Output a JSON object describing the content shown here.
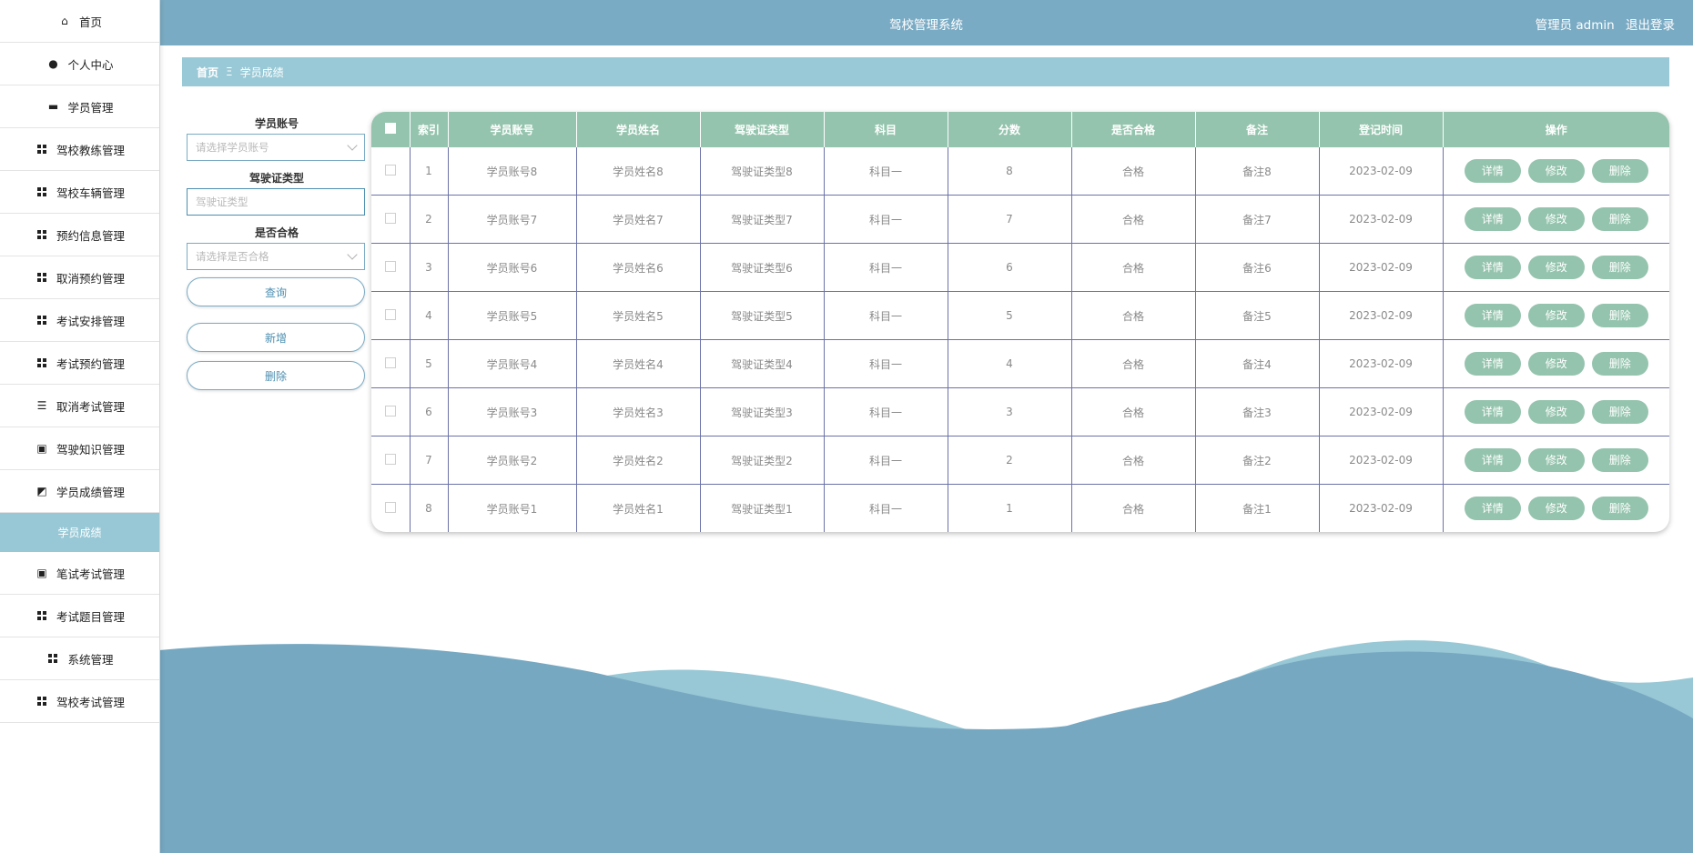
{
  "header": {
    "title": "驾校管理系统",
    "role": "管理员 admin",
    "logout": "退出登录"
  },
  "sidebar": {
    "items": [
      {
        "label": "首页",
        "icon": "home-icon"
      },
      {
        "label": "个人中心",
        "icon": "user-icon"
      },
      {
        "label": "学员管理",
        "icon": "chat-icon"
      },
      {
        "label": "驾校教练管理",
        "icon": "grid-icon"
      },
      {
        "label": "驾校车辆管理",
        "icon": "grid-icon"
      },
      {
        "label": "预约信息管理",
        "icon": "grid-icon"
      },
      {
        "label": "取消预约管理",
        "icon": "grid-icon"
      },
      {
        "label": "考试安排管理",
        "icon": "grid-icon"
      },
      {
        "label": "考试预约管理",
        "icon": "grid-icon"
      },
      {
        "label": "取消考试管理",
        "icon": "list-icon"
      },
      {
        "label": "驾驶知识管理",
        "icon": "clipboard-icon"
      },
      {
        "label": "学员成绩管理",
        "icon": "chart-icon"
      }
    ],
    "active_sub": "学员成绩",
    "items_after": [
      {
        "label": "笔试考试管理",
        "icon": "clipboard-icon"
      },
      {
        "label": "考试题目管理",
        "icon": "grid-icon"
      },
      {
        "label": "系统管理",
        "icon": "grid-icon"
      },
      {
        "label": "驾校考试管理",
        "icon": "grid-icon"
      }
    ]
  },
  "breadcrumb": {
    "home": "首页",
    "separator": "Ξ",
    "current": "学员成绩"
  },
  "search": {
    "account_label": "学员账号",
    "account_placeholder": "请选择学员账号",
    "license_label": "驾驶证类型",
    "license_placeholder": "驾驶证类型",
    "pass_label": "是否合格",
    "pass_placeholder": "请选择是否合格",
    "query_button": "查询",
    "add_button": "新增",
    "delete_button": "删除"
  },
  "table": {
    "headers": [
      "索引",
      "学员账号",
      "学员姓名",
      "驾驶证类型",
      "科目",
      "分数",
      "是否合格",
      "备注",
      "登记时间",
      "操作"
    ],
    "rows": [
      [
        "1",
        "学员账号8",
        "学员姓名8",
        "驾驶证类型8",
        "科目一",
        "8",
        "合格",
        "备注8",
        "2023-02-09"
      ],
      [
        "2",
        "学员账号7",
        "学员姓名7",
        "驾驶证类型7",
        "科目一",
        "7",
        "合格",
        "备注7",
        "2023-02-09"
      ],
      [
        "3",
        "学员账号6",
        "学员姓名6",
        "驾驶证类型6",
        "科目一",
        "6",
        "合格",
        "备注6",
        "2023-02-09"
      ],
      [
        "4",
        "学员账号5",
        "学员姓名5",
        "驾驶证类型5",
        "科目一",
        "5",
        "合格",
        "备注5",
        "2023-02-09"
      ],
      [
        "5",
        "学员账号4",
        "学员姓名4",
        "驾驶证类型4",
        "科目一",
        "4",
        "合格",
        "备注4",
        "2023-02-09"
      ],
      [
        "6",
        "学员账号3",
        "学员姓名3",
        "驾驶证类型3",
        "科目一",
        "3",
        "合格",
        "备注3",
        "2023-02-09"
      ],
      [
        "7",
        "学员账号2",
        "学员姓名2",
        "驾驶证类型2",
        "科目一",
        "2",
        "合格",
        "备注2",
        "2023-02-09"
      ],
      [
        "8",
        "学员账号1",
        "学员姓名1",
        "驾驶证类型1",
        "科目一",
        "1",
        "合格",
        "备注1",
        "2023-02-09"
      ]
    ],
    "actions": {
      "detail": "详情",
      "edit": "修改",
      "delete": "删除"
    }
  },
  "colors": {
    "header": "#7aabc4",
    "breadcrumb": "#99c9d6",
    "table_header": "#94c4ad",
    "action_button": "#94c4ad",
    "wave_light": "#98c8d6",
    "wave_dark": "#76a8c2"
  }
}
